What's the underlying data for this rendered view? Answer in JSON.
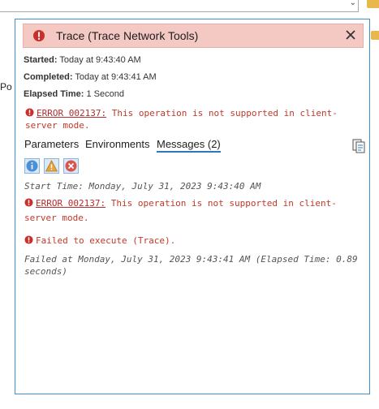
{
  "background": {
    "left_text": "Po",
    "dropdown_chevron": "chevron-down"
  },
  "dialog": {
    "title": "Trace (Trace Network Tools)",
    "status_color": "#f4c9c4",
    "started_label": "Started:",
    "started_value": "Today at 9:43:40 AM",
    "completed_label": "Completed:",
    "completed_value": "Today at 9:43:41 AM",
    "elapsed_label": "Elapsed Time:",
    "elapsed_value": "1 Second",
    "summary_error": {
      "code": "ERROR 002137:",
      "text_line1": " This operation is not supported in client-",
      "text_line2": "server mode."
    },
    "tabs": [
      {
        "label": "Parameters",
        "active": false
      },
      {
        "label": "Environments",
        "active": false
      },
      {
        "label": "Messages (2)",
        "active": true
      }
    ],
    "filter_buttons": [
      "info-icon",
      "warning-icon",
      "error-icon"
    ],
    "messages": {
      "start_time": "Start Time: Monday, July 31, 2023 9:43:40 AM",
      "error_code": "ERROR 002137:",
      "error_text_line1": " This operation is not supported in client-",
      "error_text_line2": "server mode.",
      "failed_execute": "Failed to execute (Trace).",
      "failed_at_line1": "Failed at Monday, July 31, 2023 9:43:41 AM (Elapsed Time: 0.89",
      "failed_at_line2": "seconds)"
    }
  }
}
